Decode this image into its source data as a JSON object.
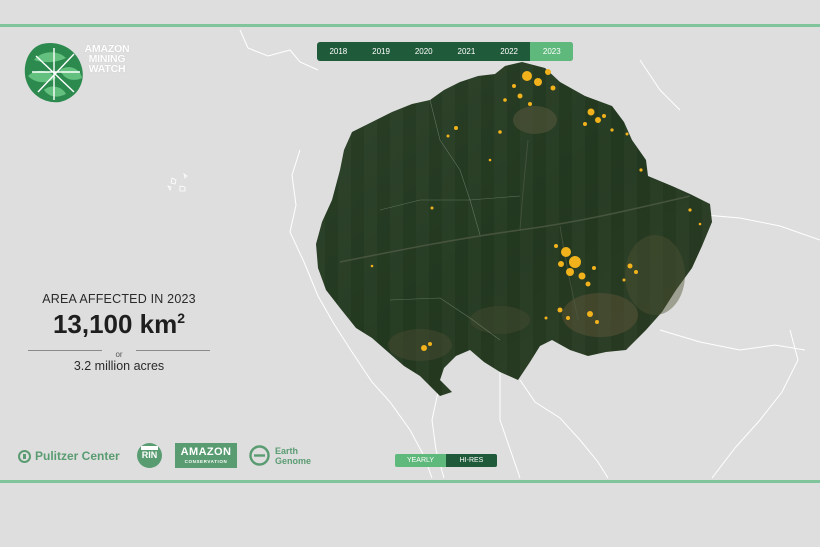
{
  "brand": {
    "logo_text": "AMAZON\nMINING\nWATCH",
    "accent": "#5fb87c",
    "dark": "#1f5b3a"
  },
  "years": {
    "items": [
      "2018",
      "2019",
      "2020",
      "2021",
      "2022",
      "2023"
    ],
    "selected": "2023"
  },
  "stats": {
    "heading": "AREA AFFECTED IN 2023",
    "value": "13,100 km",
    "value_superscript": "2",
    "separator": "or",
    "secondary": "3.2 million acres"
  },
  "partners": {
    "pulitzer": "Pulitzer Center",
    "rin": "RIN",
    "amazon_conservation_main": "AMAZON",
    "amazon_conservation_sub": "CONSERVATION",
    "earth_genome": "Earth\nGenome"
  },
  "view_toggle": {
    "options": [
      "YEARLY",
      "HI-RES"
    ],
    "selected": "HI-RES"
  },
  "map": {
    "land_color": "#dedede",
    "border_color": "#ffffff",
    "forest_color": "#243a22",
    "mining_color": "#f2b21c"
  }
}
